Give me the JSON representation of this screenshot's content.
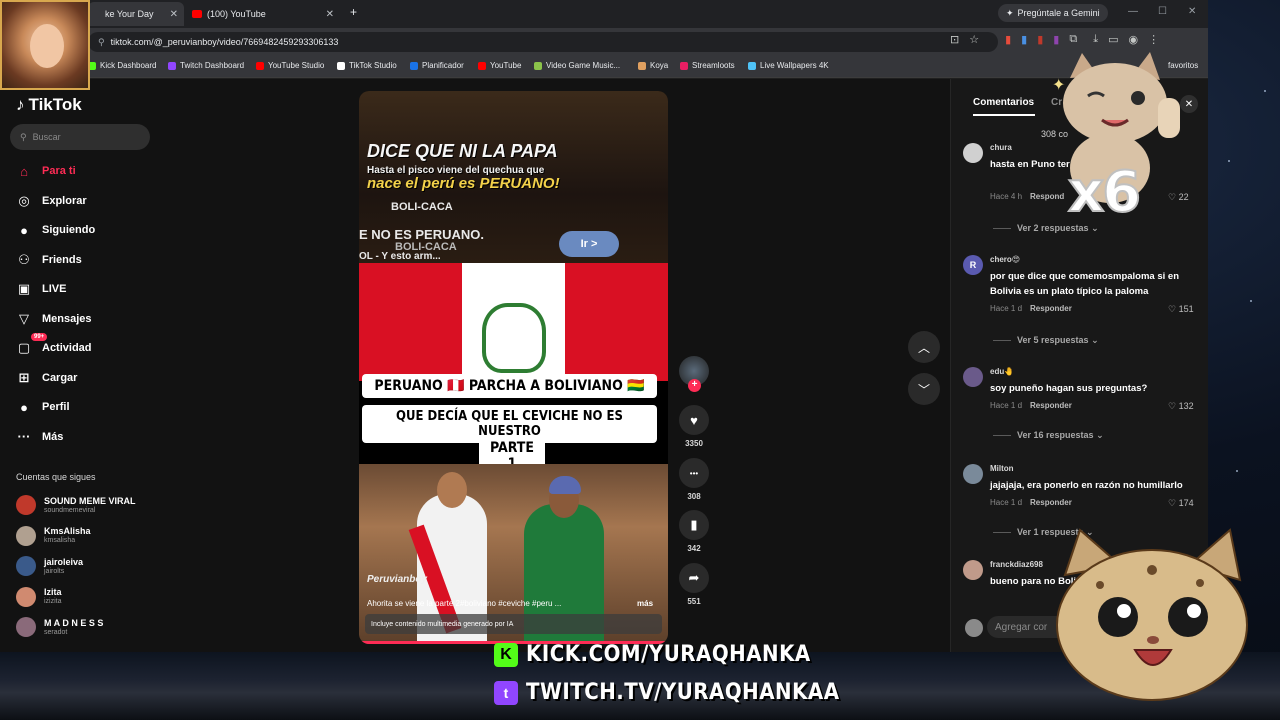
{
  "browser": {
    "tabs": [
      {
        "label": "ke Your Day",
        "favicon_color": "#35363a"
      },
      {
        "label": "(100) YouTube",
        "favicon_color": "#ff0000"
      }
    ],
    "new_tab": "+",
    "gemini": "Pregúntale a Gemini",
    "window_controls": [
      "—",
      "☐",
      "✕"
    ],
    "url": "tiktok.com/@_peruvianboy/video/7669482459293306133",
    "bookmarks": [
      {
        "label": "Kick Dashboard",
        "color": "#53fc18"
      },
      {
        "label": "Twitch Dashboard",
        "color": "#9146ff"
      },
      {
        "label": "YouTube Studio",
        "color": "#ff0000"
      },
      {
        "label": "TikTok Studio",
        "color": "#ffffff"
      },
      {
        "label": "Planificador",
        "color": "#1a73e8"
      },
      {
        "label": "YouTube",
        "color": "#ff0000"
      },
      {
        "label": "Video Game Music...",
        "color": "#8bc34a"
      },
      {
        "label": "Koya",
        "color": "#e0a060"
      },
      {
        "label": "Streamloots",
        "color": "#e91e63"
      },
      {
        "label": "Live Wallpapers 4K",
        "color": "#4fc3f7"
      }
    ],
    "bookmarks_all": "favoritos"
  },
  "tiktok": {
    "logo": "TikTok",
    "search_placeholder": "Buscar",
    "nav": [
      {
        "label": "Para ti",
        "icon": "home-icon",
        "glyph": "⌂",
        "active": true
      },
      {
        "label": "Explorar",
        "icon": "compass-icon",
        "glyph": "◎"
      },
      {
        "label": "Siguiendo",
        "icon": "following-icon",
        "glyph": "●"
      },
      {
        "label": "Friends",
        "icon": "friends-icon",
        "glyph": "⚇"
      },
      {
        "label": "LIVE",
        "icon": "live-icon",
        "glyph": "▣"
      },
      {
        "label": "Mensajes",
        "icon": "messages-icon",
        "glyph": "▽"
      },
      {
        "label": "Actividad",
        "icon": "activity-icon",
        "glyph": "▢",
        "badge": "99+"
      },
      {
        "label": "Cargar",
        "icon": "upload-icon",
        "glyph": "⊞"
      },
      {
        "label": "Perfil",
        "icon": "profile-icon",
        "glyph": "●"
      },
      {
        "label": "Más",
        "icon": "more-icon",
        "glyph": "···"
      }
    ],
    "following_title": "Cuentas que sigues",
    "following": [
      {
        "name": "SOUND MEME VIRAL",
        "handle": "soundmemeviral",
        "color": "#c0392b"
      },
      {
        "name": "KmsAlisha",
        "handle": "kmsalisha",
        "color": "#b0a090"
      },
      {
        "name": "jairoleiva",
        "handle": "jairolts",
        "color": "#3a5a8a"
      },
      {
        "name": "Izita",
        "handle": "izizita",
        "color": "#d08a70"
      },
      {
        "name": "M A D N E S S",
        "handle": "seradot",
        "color": "#8a6a7a"
      }
    ]
  },
  "video": {
    "top_lines": [
      "DICE QUE NI LA PAPA",
      "Hasta el pisco viene del quechua que",
      "nace el perú es PERUANO!"
    ],
    "top_tags": [
      "BOLI-CACA",
      "E NO ES PERUANO.",
      "BOLI-CACA",
      "OL - Y esto arm..."
    ],
    "go_button": "Ir >",
    "title_lines": [
      "PERUANO 🇵🇪 PARCHA A BOLIVIANO 🇧🇴",
      "QUE DECÍA QUE EL CEVICHE NO ES NUESTRO",
      "PARTE 1"
    ],
    "watermark": "Peruvianboy",
    "caption": "Ahorita se viene la parte 2#boliviano #ceviche #peru ...",
    "more": "más",
    "ai_notice": "Incluye contenido multimedia generado por IA"
  },
  "actions": [
    {
      "name": "like",
      "icon": "heart-icon",
      "glyph": "♥",
      "count": "3350"
    },
    {
      "name": "comment",
      "icon": "comment-icon",
      "glyph": "•••",
      "count": "308"
    },
    {
      "name": "save",
      "icon": "bookmark-icon",
      "glyph": "▮",
      "count": "342"
    },
    {
      "name": "share",
      "icon": "share-icon",
      "glyph": "➦",
      "count": "551"
    }
  ],
  "comments_panel": {
    "tab_comments": "Comentarios",
    "tab_creator": "Cr",
    "count": "308 co",
    "close": "✕",
    "items": [
      {
        "user": "chura",
        "text": "hasta en Puno ter                 cha jajaja.",
        "time": "Hace 4 h",
        "reply": "Respond",
        "likes": "22",
        "replies": "Ver 2 respuestas",
        "av": "#d0d0d0"
      },
      {
        "user": "chero😍",
        "text": "por que dice que comemosmpaloma si en Bolivia es un plato típico la paloma",
        "time": "Hace 1 d",
        "reply": "Responder",
        "likes": "151",
        "replies": "Ver 5 respuestas",
        "av": "#5a5ab0",
        "initial": "R"
      },
      {
        "user": "edu🤚",
        "text": "soy puneño hagan sus preguntas?",
        "time": "Hace 1 d",
        "reply": "Responder",
        "likes": "132",
        "replies": "Ver 16 respuestas",
        "av": "#6a5a8a"
      },
      {
        "user": "Milton",
        "text": "jajajaja, era ponerlo en razón no humillarlo",
        "time": "Hace 1 d",
        "reply": "Responder",
        "likes": "174",
        "replies": "Ver 1 respuesta",
        "av": "#7a8a9a"
      },
      {
        "user": "franckdiaz698",
        "text": "bueno para no Boliviano, hay c",
        "av": "#c09a8a"
      }
    ],
    "add_placeholder": "Agregar cor"
  },
  "overlay": {
    "multiplier": "x6",
    "kick": "KICK.COM/YURAQHANKA",
    "kick_logo": "K",
    "twitch": "TWITCH.TV/YURAQHANKAA",
    "twitch_logo": "t"
  }
}
